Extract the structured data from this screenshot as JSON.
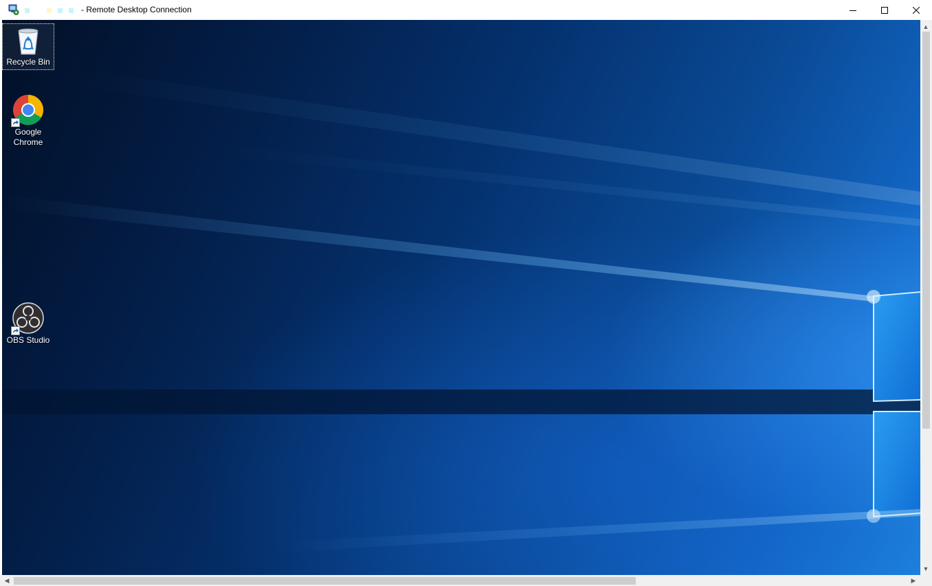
{
  "window": {
    "title": "- Remote Desktop Connection",
    "redacted_colors": [
      "#c8f4f8",
      "#fcf8c0",
      "#c8f4f8",
      "#c8f4f8"
    ],
    "controls": {
      "minimize_icon": "minimize-icon",
      "maximize_icon": "maximize-icon",
      "close_icon": "close-icon"
    }
  },
  "desktop": {
    "icons": [
      {
        "label": "Recycle Bin",
        "icon": "recycle-bin-icon",
        "selected": true
      },
      {
        "label": "Google Chrome",
        "icon": "chrome-icon",
        "shortcut": true
      },
      {
        "label": "OBS Studio",
        "icon": "obs-icon",
        "shortcut": true
      }
    ]
  },
  "scrollbars": {
    "vertical": {
      "up_arrow": "▲",
      "down_arrow": "▼"
    },
    "horizontal": {
      "left_arrow": "◀",
      "right_arrow": "▶"
    }
  },
  "colors": {
    "wallpaper_dark": "#021027",
    "wallpaper_light": "#1e83de",
    "accent_glow": "#9fdcff"
  }
}
